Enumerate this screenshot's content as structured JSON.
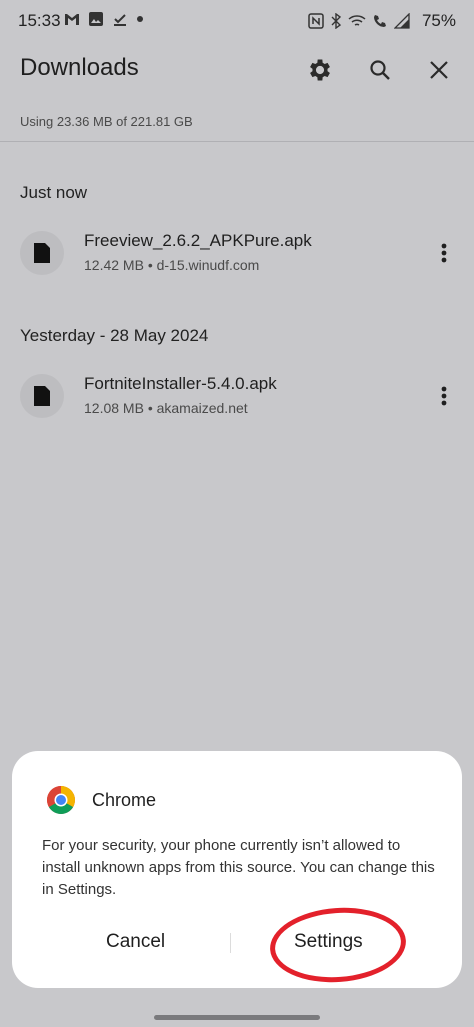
{
  "status_bar": {
    "time": "15:33",
    "battery": "75%",
    "left_icons": [
      "gmail-icon",
      "gallery-icon",
      "download-done-icon",
      "dot-icon"
    ],
    "right_icons": [
      "nfc-icon",
      "bluetooth-icon",
      "wifi-icon",
      "wifi-calling-icon",
      "signal-icon"
    ]
  },
  "app_bar": {
    "title": "Downloads",
    "actions": [
      "gear-icon",
      "search-icon",
      "close-icon"
    ]
  },
  "storage": {
    "usage_text": "Using 23.36 MB of 221.81 GB"
  },
  "sections": [
    {
      "title": "Just now",
      "items": [
        {
          "name": "Freeview_2.6.2_APKPure.apk",
          "meta": "12.42 MB • d-15.winudf.com"
        }
      ]
    },
    {
      "title": "Yesterday - 28 May 2024",
      "items": [
        {
          "name": "FortniteInstaller-5.4.0.apk",
          "meta": "12.08 MB • akamaized.net"
        }
      ]
    }
  ],
  "dialog": {
    "app_name": "Chrome",
    "message": "For your security, your phone currently isn’t allowed to install unknown apps from this source. You can change this in Settings.",
    "cancel_label": "Cancel",
    "settings_label": "Settings",
    "highlight_color": "#e3212b"
  },
  "colors": {
    "background": "#c8c8cb",
    "dialog": "#ffffff"
  }
}
